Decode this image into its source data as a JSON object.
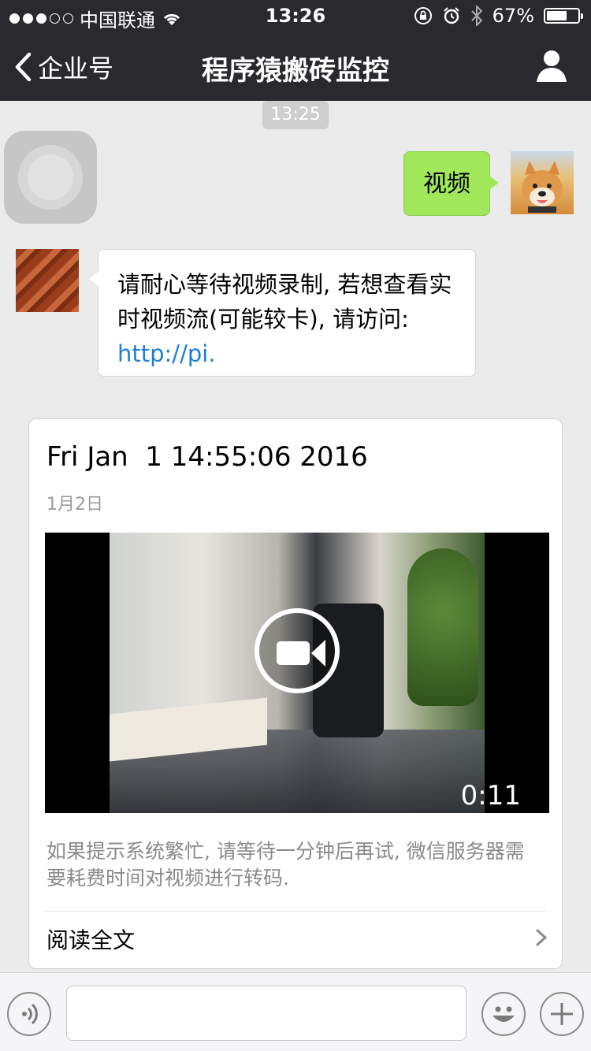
{
  "status_bar": {
    "carrier": "中国联通",
    "time": "13:26",
    "battery": "67%",
    "battery_level": 0.67
  },
  "nav": {
    "back_label": "企业号",
    "title": "程序猿搬砖监控"
  },
  "chat": {
    "time_stamp": "13:25",
    "sent_message": "视频",
    "reply_text": "请耐心等待视频录制, 若想查看实时视频流(可能较卡), 请访问: ",
    "reply_link": "http://pi."
  },
  "article": {
    "title": "Fri Jan  1 14:55:06 2016",
    "date": "1月2日",
    "video_duration": "0:11",
    "description": "如果提示系统繁忙, 请等待一分钟后再试, 微信服务器需要耗费时间对视频进行转码.",
    "read_all": "阅读全文"
  },
  "icons": {
    "wifi": "wifi-icon",
    "alarm": "alarm-icon",
    "bluetooth": "bluetooth-icon",
    "lock_rotation": "orientation-lock-icon",
    "person": "person-icon",
    "voice": "voice-icon",
    "emoji": "emoji-icon",
    "plus": "plus-icon"
  }
}
